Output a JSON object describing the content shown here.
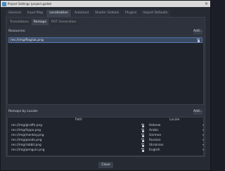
{
  "window": {
    "title": "Project Settings (project.godot)",
    "close_glyph": "×"
  },
  "tabs": [
    "General",
    "Input Map",
    "Localization",
    "Autoload",
    "Shader Globals",
    "Plugins",
    "Import Defaults"
  ],
  "active_tab": "Localization",
  "subtabs": [
    "Translations",
    "Remaps",
    "POT Generation"
  ],
  "active_subtab": "Remaps",
  "resources": {
    "label": "Resources:",
    "add_label": "Add...",
    "items": [
      "res://img/flag/uk.png"
    ]
  },
  "remaps": {
    "label": "Remaps by Locale:",
    "add_label": "Add...",
    "columns": {
      "path": "Path",
      "locale": "Locale"
    },
    "rows": [
      {
        "path": "res://img/giraffe.png",
        "locale": "Hebrew"
      },
      {
        "path": "res://img/hippo.png",
        "locale": "Arabic"
      },
      {
        "path": "res://img/monkey.png",
        "locale": "German"
      },
      {
        "path": "res://img/panda.png",
        "locale": "Russian"
      },
      {
        "path": "res://img/rabbit.png",
        "locale": "Ukrainian"
      },
      {
        "path": "res://img/penguin.png",
        "locale": "English"
      }
    ]
  },
  "footer": {
    "close_label": "Close"
  },
  "colors": {
    "accent": "#478cbf",
    "selected_row": "#3a4a63",
    "background": "#252a33"
  }
}
